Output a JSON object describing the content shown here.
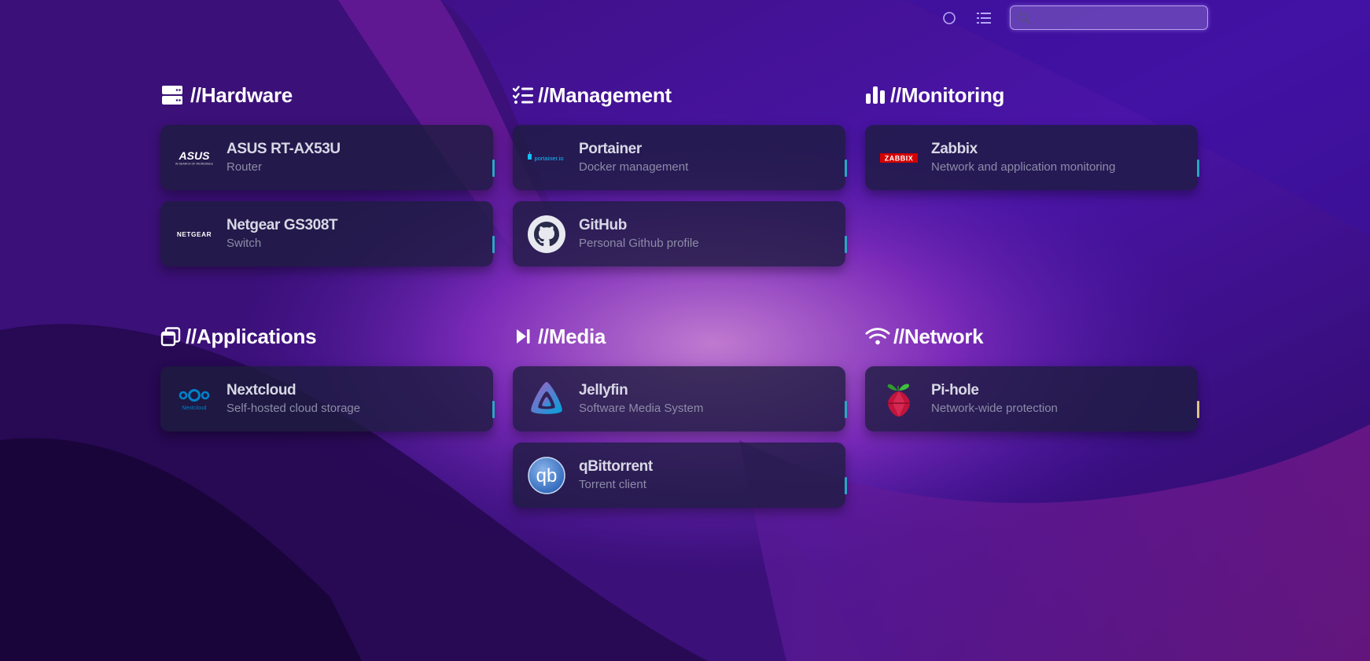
{
  "toolbar": {
    "search_placeholder": "",
    "theme_icon": "circle-icon",
    "layout_icon": "list-icon",
    "search_icon": "search-icon"
  },
  "colors": {
    "status_ok": "#2aa6c4",
    "status_warn": "#e0c68a",
    "card_bg": "rgba(28,28,62,0.78)"
  },
  "groups": [
    {
      "title": "//Hardware",
      "icon": "server-icon",
      "items": [
        {
          "name": "ASUS RT-AX53U",
          "description": "Router",
          "logo": "asus-logo",
          "logo_text": "ASUS",
          "logo_tagline": "IN SEARCH OF INCREDIBLE"
        },
        {
          "name": "Netgear GS308T",
          "description": "Switch",
          "logo": "netgear-logo",
          "logo_text": "NETGEAR"
        }
      ]
    },
    {
      "title": "//Management",
      "icon": "checklist-icon",
      "items": [
        {
          "name": "Portainer",
          "description": "Docker management",
          "logo": "portainer-logo",
          "logo_text": "portainer.io"
        },
        {
          "name": "GitHub",
          "description": "Personal Github profile",
          "logo": "github-logo"
        }
      ]
    },
    {
      "title": "//Monitoring",
      "icon": "bar-chart-icon",
      "items": [
        {
          "name": "Zabbix",
          "description": "Network and application monitoring",
          "logo": "zabbix-logo",
          "logo_text": "ZABBIX"
        }
      ]
    },
    {
      "title": "//Applications",
      "icon": "windows-icon",
      "items": [
        {
          "name": "Nextcloud",
          "description": "Self-hosted cloud storage",
          "logo": "nextcloud-logo",
          "logo_text": "Nextcloud"
        }
      ]
    },
    {
      "title": "//Media",
      "icon": "play-next-icon",
      "items": [
        {
          "name": "Jellyfin",
          "description": "Software Media System",
          "logo": "jellyfin-logo"
        },
        {
          "name": "qBittorrent",
          "description": "Torrent client",
          "logo": "qbittorrent-logo",
          "logo_text": "qb"
        }
      ]
    },
    {
      "title": "//Network",
      "icon": "wifi-icon",
      "items": [
        {
          "name": "Pi-hole",
          "description": "Network-wide protection",
          "logo": "pihole-logo",
          "status": "warn"
        }
      ]
    }
  ]
}
